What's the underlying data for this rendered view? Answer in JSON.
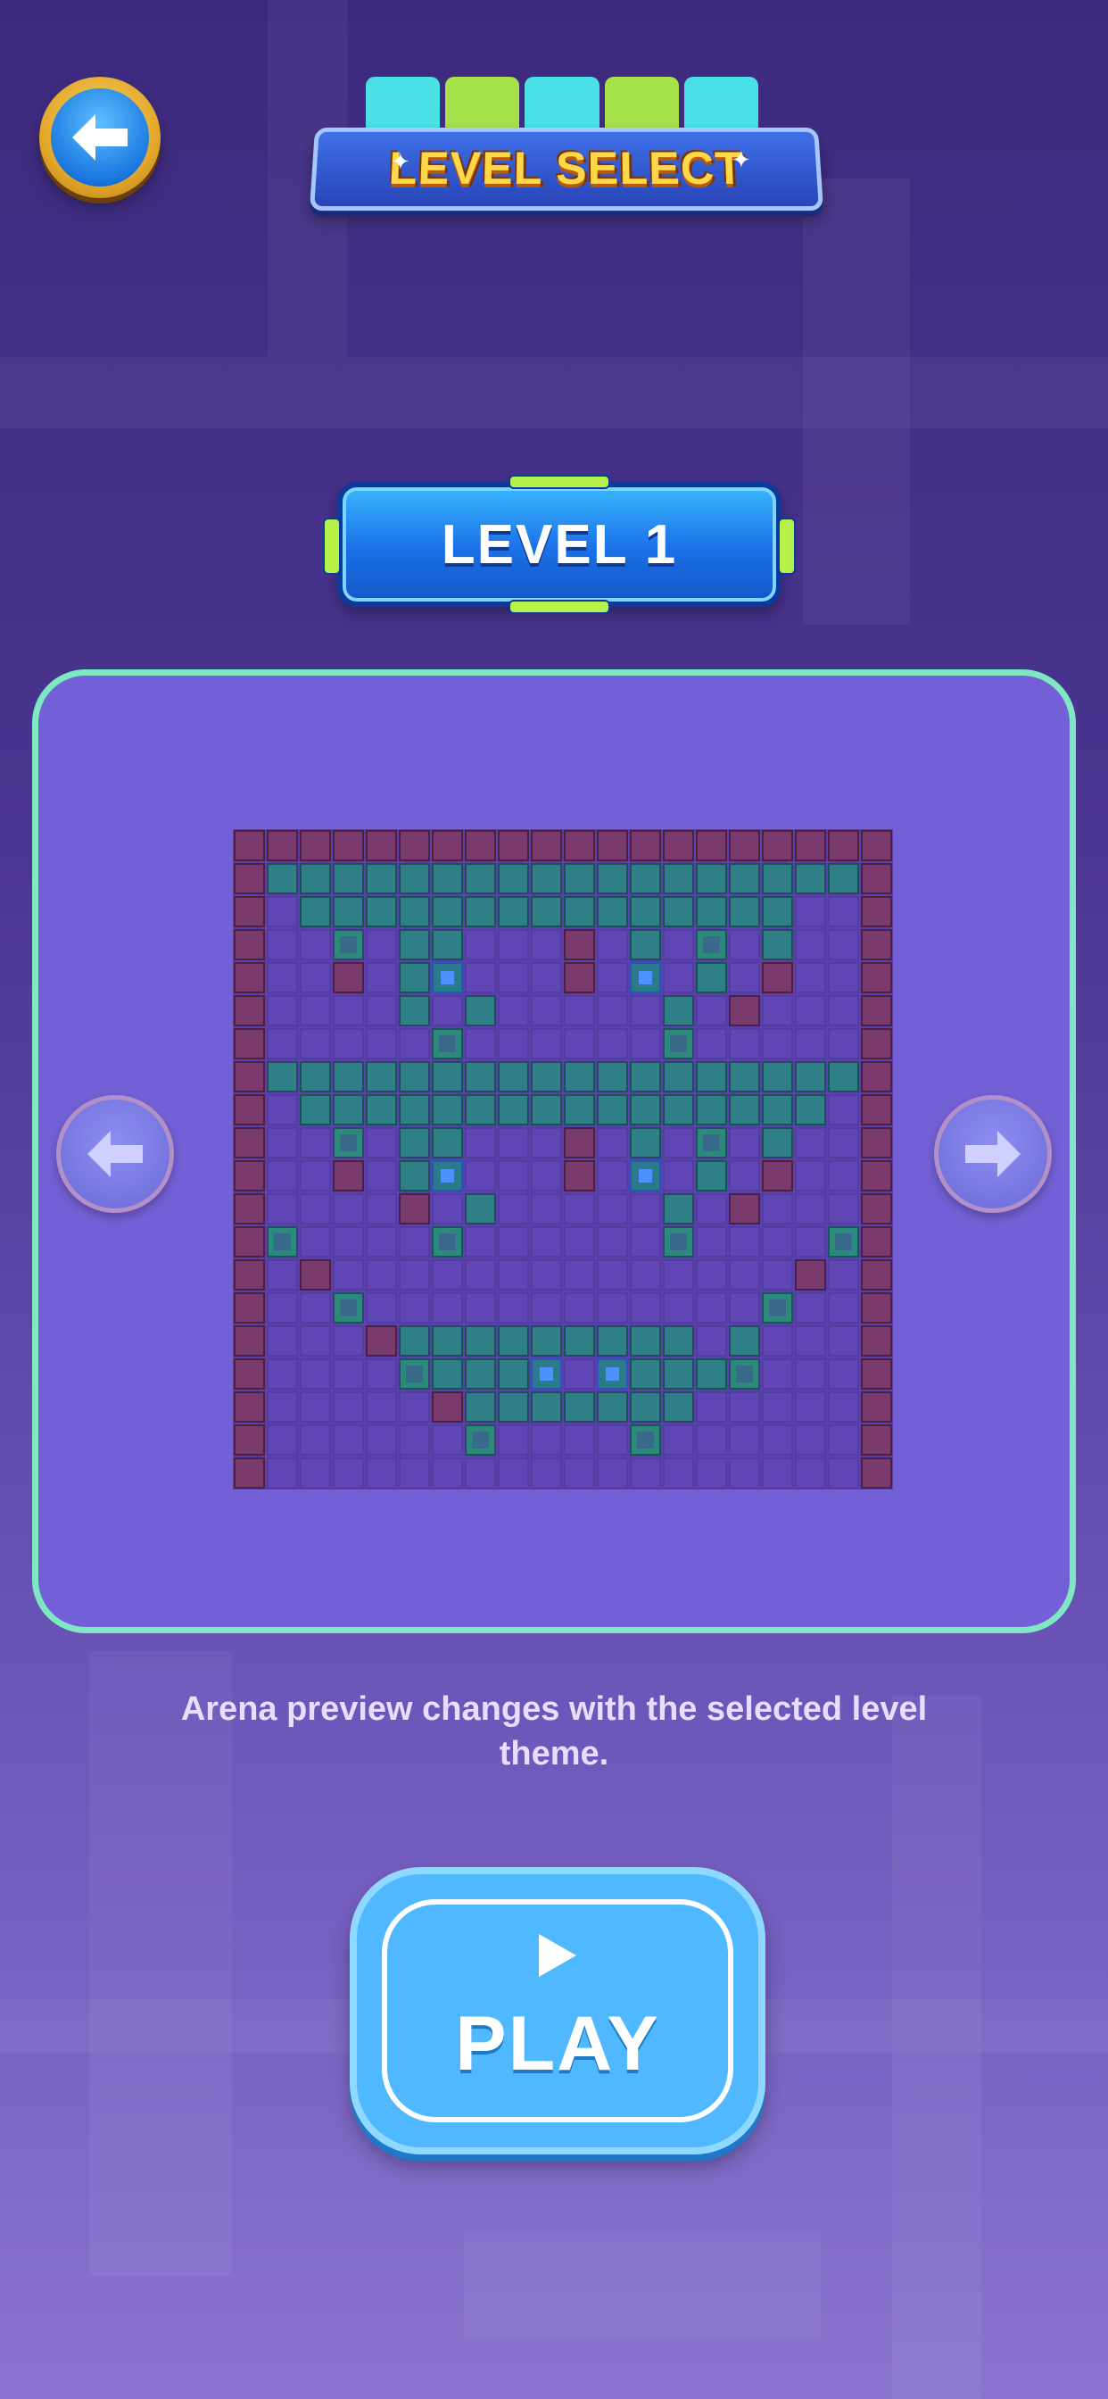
{
  "header": {
    "back_icon": "arrow-left-icon",
    "title": "LEVEL SELECT"
  },
  "level": {
    "label": "LEVEL 1"
  },
  "preview": {
    "prev_icon": "arrow-left-icon",
    "next_icon": "arrow-right-icon",
    "hint": "Arena preview changes with the selected level theme.",
    "grid_size": 20,
    "colors": {
      "floor": "#5f46b4",
      "wall": "#7a3a6e",
      "block": "#2f7f87",
      "spike": "#3a6a8a",
      "gem": "#4d90ff"
    },
    "rows": [
      "11111111111111111111",
      "12222222222222222221",
      "10222222222222222001",
      "10030220001020302001",
      "10010240001040201001",
      "10000202000002010001",
      "10000030000003000001",
      "12222222222222222221",
      "10222222222222222201",
      "10030220001020302001",
      "10010240001040201001",
      "10000102000002010001",
      "13000030000003000031",
      "10100000000000000101",
      "10030000000000003001",
      "10001222222222020001",
      "10000322240422230001",
      "10000012222222000001",
      "10000003000030000001",
      "10000000000000000001"
    ]
  },
  "play": {
    "icon": "play-icon",
    "label": "PLAY"
  },
  "theme": {
    "accent": "#4fb8ff",
    "panel_border": "#7ee8c3",
    "title_text": "#ffd84a"
  }
}
